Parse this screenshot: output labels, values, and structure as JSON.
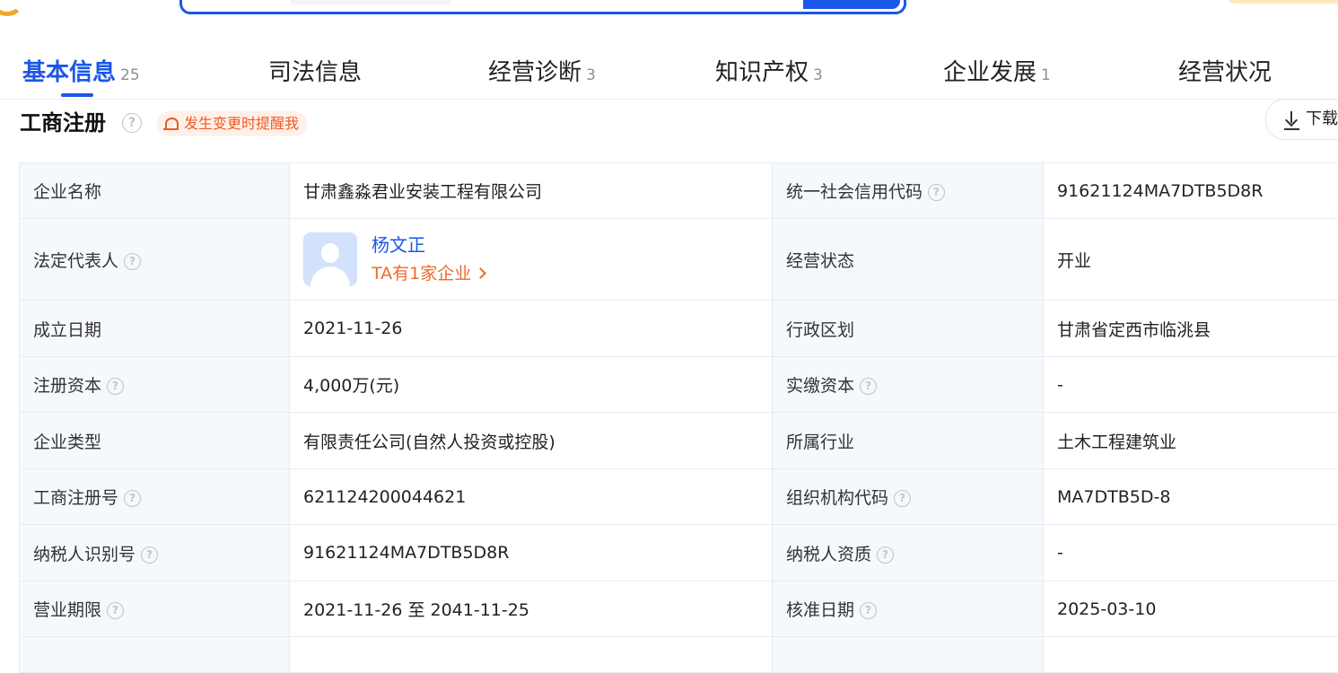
{
  "tabs": [
    {
      "label": "基本信息",
      "count": "25"
    },
    {
      "label": "司法信息",
      "count": ""
    },
    {
      "label": "经营诊断",
      "count": "3"
    },
    {
      "label": "知识产权",
      "count": "3"
    },
    {
      "label": "企业发展",
      "count": "1"
    },
    {
      "label": "经营状况",
      "count": ""
    }
  ],
  "section": {
    "title": "工商注册",
    "remind_label": "发生变更时提醒我",
    "download_label": "下载"
  },
  "help_glyph": "?",
  "rows": [
    {
      "l1": "企业名称",
      "v1": "甘肃鑫淼君业安装工程有限公司",
      "l2": "统一社会信用代码",
      "v2": "91621124MA7DTB5D8R"
    },
    {
      "l1": "法定代表人",
      "l2": "经营状态",
      "v2": "开业"
    },
    {
      "l1": "成立日期",
      "v1": "2021-11-26",
      "l2": "行政区划",
      "v2": "甘肃省定西市临洮县"
    },
    {
      "l1": "注册资本",
      "v1": "4,000万(元)",
      "l2": "实缴资本",
      "v2": "-"
    },
    {
      "l1": "企业类型",
      "v1": "有限责任公司(自然人投资或控股)",
      "l2": "所属行业",
      "v2": "土木工程建筑业"
    },
    {
      "l1": "工商注册号",
      "v1": "621124200044621",
      "l2": "组织机构代码",
      "v2": "MA7DTB5D-8"
    },
    {
      "l1": "纳税人识别号",
      "v1": "91621124MA7DTB5D8R",
      "l2": "纳税人资质",
      "v2": "-"
    },
    {
      "l1": "营业期限",
      "v1": "2021-11-26 至 2041-11-25",
      "l2": "核准日期",
      "v2": "2025-03-10"
    }
  ],
  "legal_rep": {
    "name": "杨文正",
    "link": "TA有1家企业"
  },
  "icons": {
    "help": "question-circle-icon",
    "bell": "bell-icon",
    "download": "download-icon",
    "chevron": "chevron-right-icon",
    "avatar": "person-avatar-icon"
  },
  "colors": {
    "primary": "#1b57e8",
    "accent_orange": "#f06a2c",
    "label_bg": "#f5f8fd",
    "border": "#e8ebf0"
  }
}
